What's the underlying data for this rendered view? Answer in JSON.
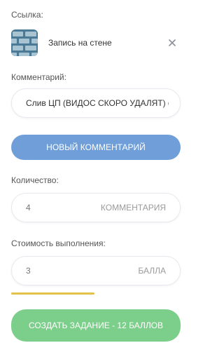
{
  "link": {
    "label": "Ссылка:",
    "title": "Запись на стене",
    "thumbnail_icon": "brick-wall-icon",
    "remove_icon": "close-icon"
  },
  "comment": {
    "label": "Комментарий:",
    "value": "Слив ЦП (ВИДОС СКОРО УДАЛЯТ) gc"
  },
  "new_comment_button": "Новый комментарий",
  "quantity": {
    "label": "Количество:",
    "value": "4",
    "unit": "комментария"
  },
  "cost": {
    "label": "Стоимость выполнения:",
    "value": "3",
    "unit": "балла"
  },
  "progress": {
    "fraction": 0.49,
    "color": "#e2c24a"
  },
  "create_button": "Создать задание - 12 баллов",
  "colors": {
    "blue_button": "#6f9ed8",
    "green_button": "#7ccf8a",
    "border": "#e6e9ee"
  }
}
